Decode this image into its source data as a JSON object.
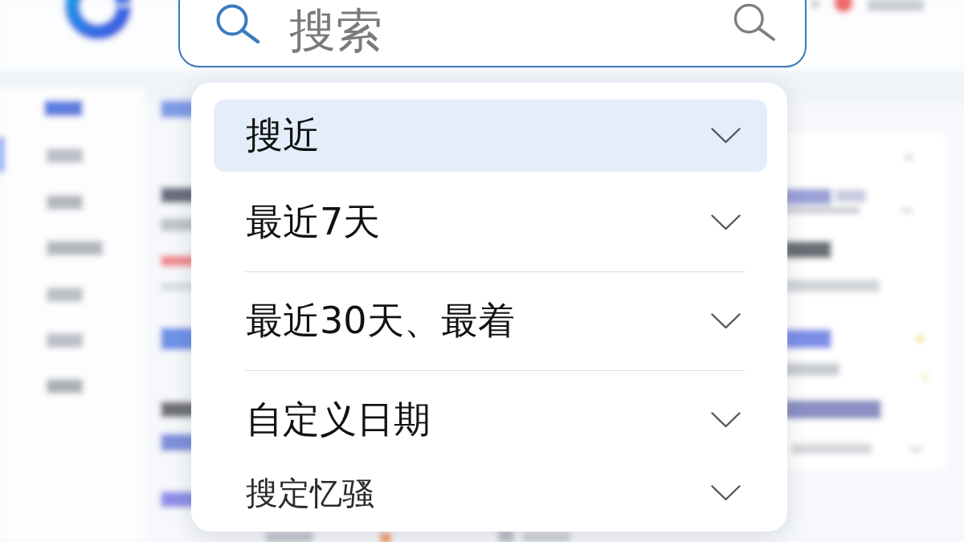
{
  "search": {
    "placeholder": "搜索"
  },
  "menu": {
    "groups": [
      {
        "items": [
          {
            "label": "搜近",
            "selected": true,
            "kind": "option"
          },
          {
            "label": "最近7天",
            "selected": false,
            "kind": "option"
          }
        ]
      },
      {
        "items": [
          {
            "label": "最近30天、最着",
            "selected": false,
            "kind": "option"
          }
        ]
      },
      {
        "items": [
          {
            "label": "自定义日期",
            "selected": false,
            "kind": "option"
          },
          {
            "label": "搜定忆骚",
            "selected": false,
            "kind": "note"
          }
        ]
      }
    ]
  }
}
